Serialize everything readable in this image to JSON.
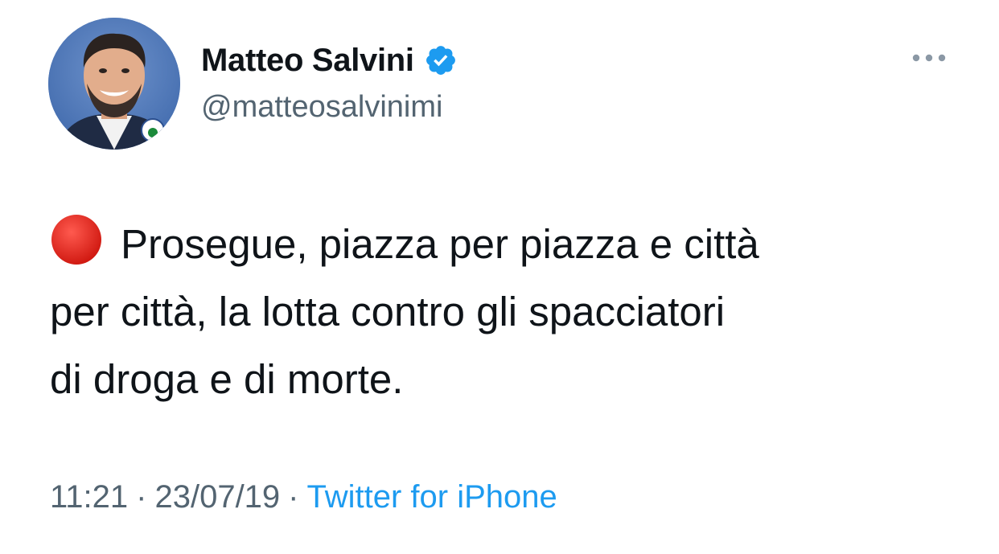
{
  "author": {
    "display_name": "Matteo Salvini",
    "handle": "@matteosalvinimi",
    "verified": true,
    "verified_color": "#1d9bf0"
  },
  "tweet": {
    "emoji": "red-circle",
    "lines": [
      "Prosegue, piazza per piazza e città",
      "per città, la lotta contro gli spacciatori",
      "di droga e di morte."
    ]
  },
  "meta": {
    "time": "11:21",
    "separator": "·",
    "date": "23/07/19",
    "source": "Twitter for iPhone"
  },
  "colors": {
    "text": "#0f1419",
    "secondary": "#536471",
    "link": "#1d9bf0"
  },
  "icons": {
    "more": "more-horizontal-icon",
    "verified": "verified-badge-icon"
  }
}
